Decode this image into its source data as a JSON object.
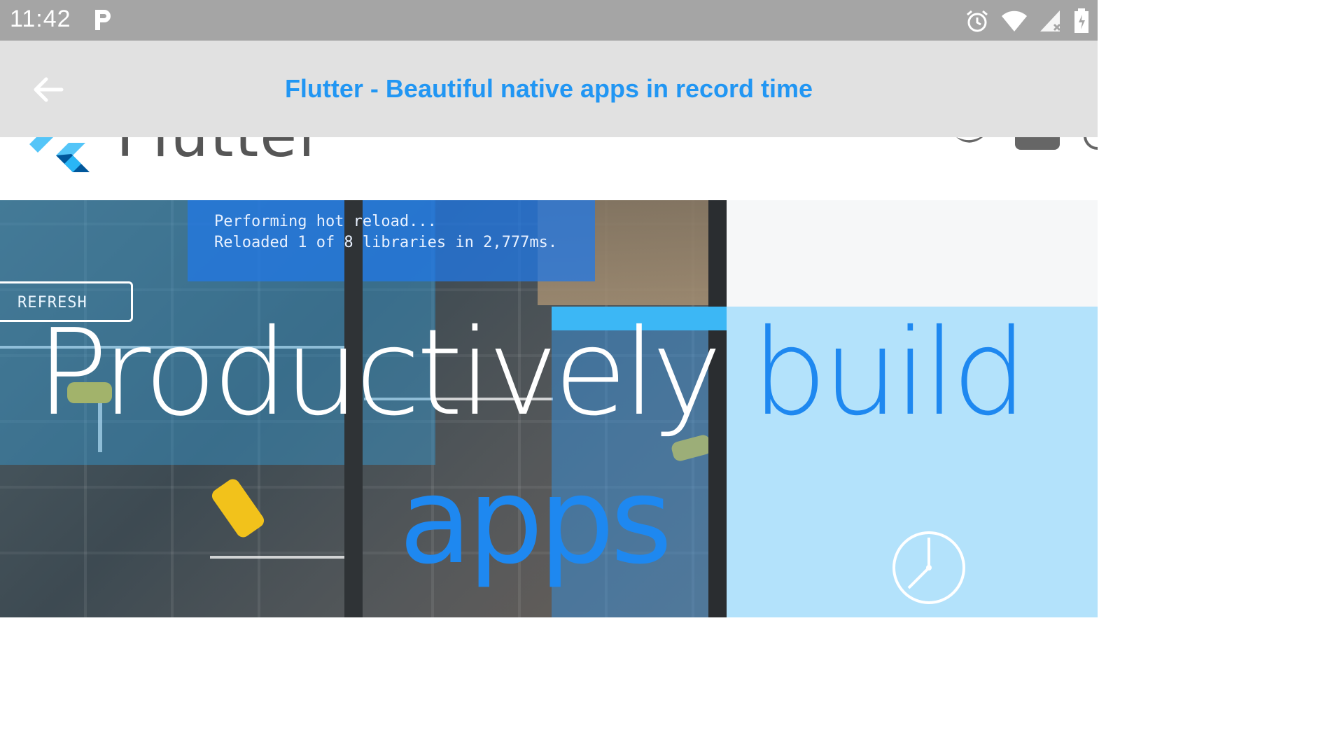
{
  "status_bar": {
    "time": "11:42",
    "parking_icon": "p-icon",
    "icons": [
      "alarm-icon",
      "wifi-icon",
      "signal-icon",
      "battery-icon"
    ]
  },
  "app_bar": {
    "back_icon": "arrow-left-icon",
    "title": "Flutter - Beautiful native apps in record time",
    "title_color": "#2196f3"
  },
  "site_header": {
    "logo_text": "Flutter",
    "social_icons": [
      "twitter-icon",
      "youtube-icon",
      "github-icon"
    ]
  },
  "hero": {
    "console_line_1": "Performing hot reload...",
    "console_line_2": "Reloaded 1 of 8 libraries in 2,777ms.",
    "refresh_label": "REFRESH",
    "headline_white": "Productively",
    "headline_blue": "build",
    "headline_line2": "apps",
    "accent_color": "#1e88f0"
  }
}
